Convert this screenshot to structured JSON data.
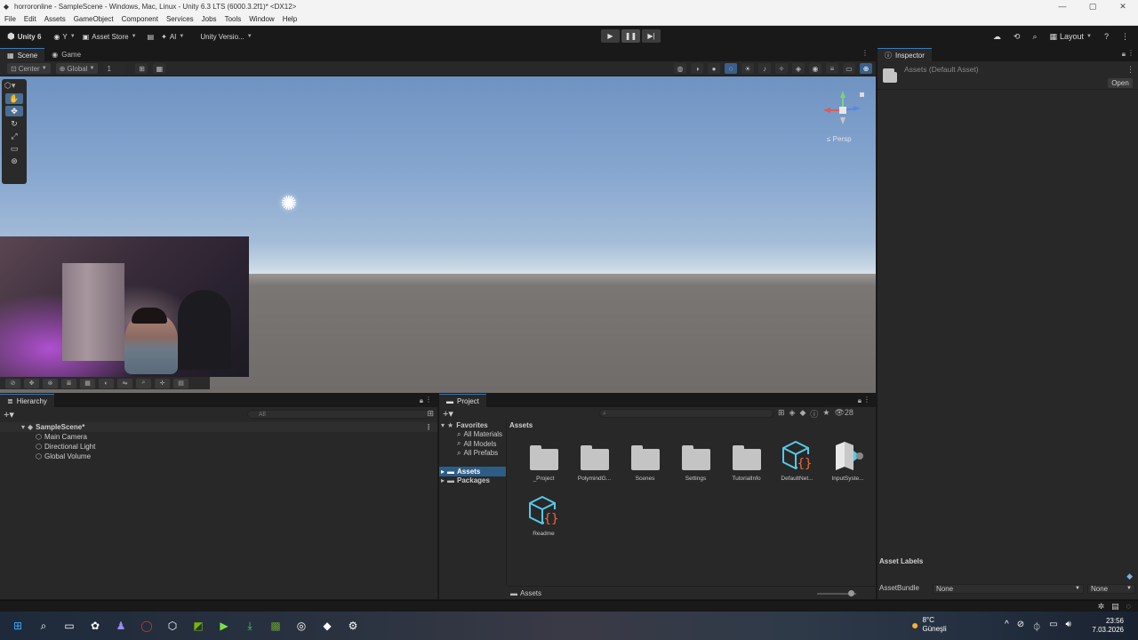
{
  "window": {
    "title": "horroronline - SampleScene - Windows, Mac, Linux - Unity 6.3 LTS (6000.3.2f1)* <DX12>",
    "controls": [
      "—",
      "▢",
      "✕"
    ]
  },
  "menu": [
    "File",
    "Edit",
    "Assets",
    "GameObject",
    "Component",
    "Services",
    "Jobs",
    "Tools",
    "Window",
    "Help"
  ],
  "toolbar": {
    "unity_label": "Unity 6",
    "account_label": "Y",
    "asset_store_label": "Asset Store",
    "ai_label": "AI",
    "version_label": "Unity Versio...",
    "layout_label": "Layout"
  },
  "scene": {
    "tabs": [
      "Scene",
      "Game"
    ],
    "center_label": "Center",
    "global_label": "Global",
    "grid_value": "1",
    "persp_label": "≤ Persp"
  },
  "hierarchy": {
    "tab": "Hierarchy",
    "search_placeholder": "All",
    "scene_name": "SampleScene*",
    "items": [
      "Main Camera",
      "Directional Light",
      "Global Volume"
    ]
  },
  "project": {
    "tab": "Project",
    "favorites_label": "Favorites",
    "favorites": [
      "All Materials",
      "All Models",
      "All Prefabs"
    ],
    "tree": [
      "Assets",
      "Packages"
    ],
    "breadcrumb": "Assets",
    "count_badge": "28",
    "assets": [
      {
        "label": "_Project",
        "type": "folder"
      },
      {
        "label": "PolymindG...",
        "type": "folder"
      },
      {
        "label": "Scenes",
        "type": "folder"
      },
      {
        "label": "Settings",
        "type": "folder"
      },
      {
        "label": "TutorialInfo",
        "type": "folder"
      },
      {
        "label": "DefaultNet...",
        "type": "script"
      },
      {
        "label": "InputSyste...",
        "type": "input"
      },
      {
        "label": "Readme",
        "type": "script"
      }
    ],
    "footer_path": "Assets"
  },
  "inspector": {
    "tab": "Inspector",
    "title": "Assets (Default Asset)",
    "open_label": "Open",
    "asset_labels_title": "Asset Labels",
    "asset_bundle_label": "AssetBundle",
    "bundle_value": "None",
    "variant_value": "None"
  },
  "taskbar": {
    "weather_temp": "8°C",
    "weather_desc": "Güneşli",
    "time": "23:56",
    "date": "7.03.2026"
  }
}
